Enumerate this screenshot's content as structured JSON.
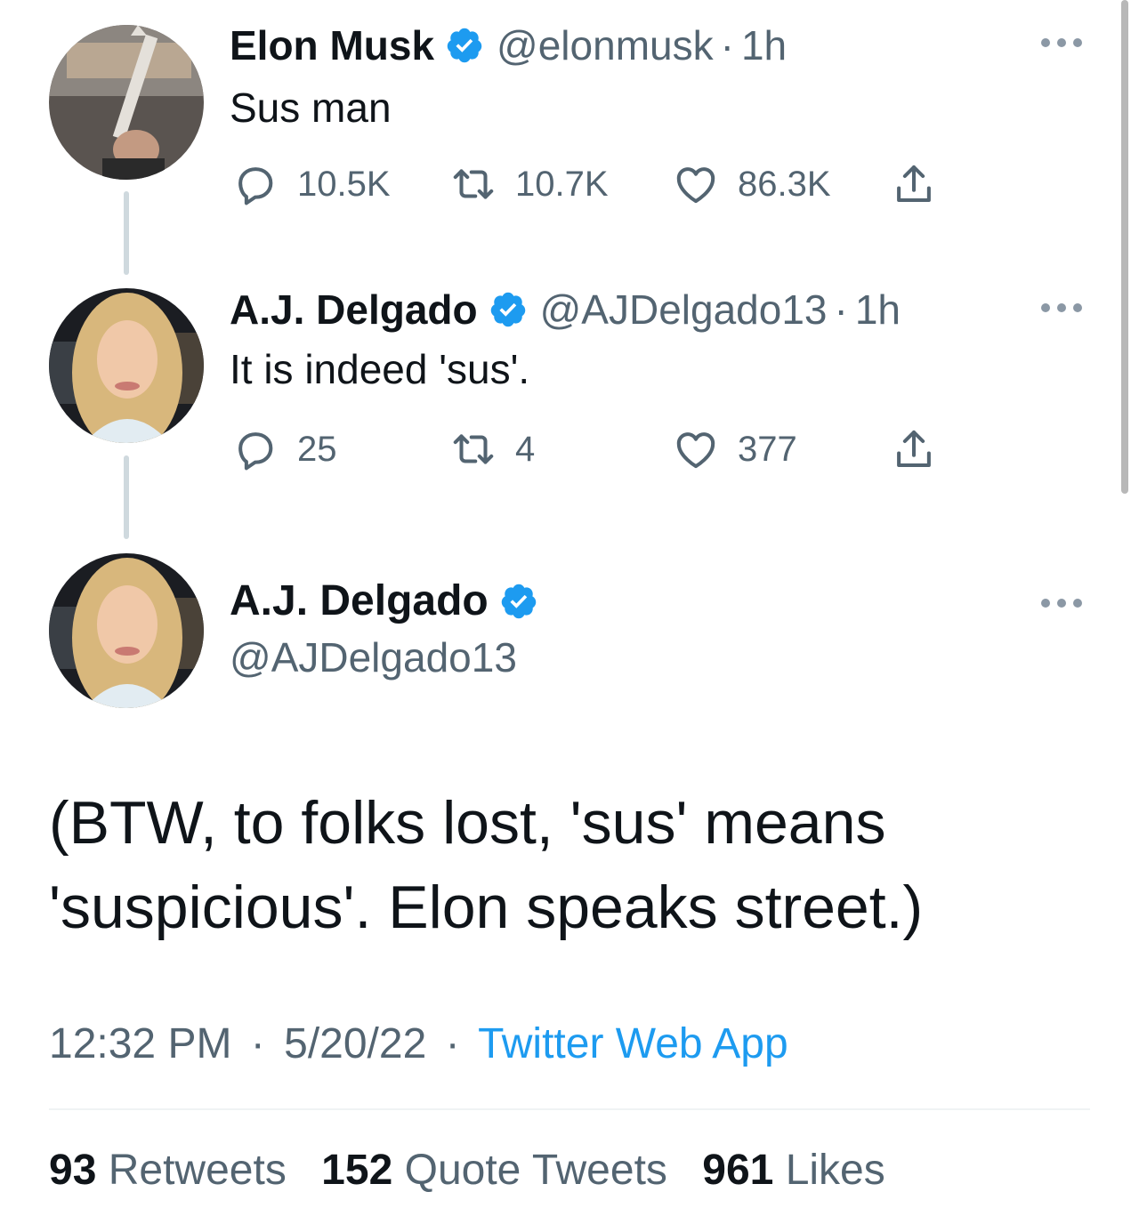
{
  "colors": {
    "text": "#0f1419",
    "secondary": "#536471",
    "verified": "#1d9bf0",
    "link": "#1d9bf0",
    "thread_line": "#cfd9de"
  },
  "tweets": [
    {
      "name": "Elon Musk",
      "verified": true,
      "handle": "@elonmusk",
      "separator": "·",
      "time": "1h",
      "text": "Sus man",
      "replies": "10.5K",
      "retweets": "10.7K",
      "likes": "86.3K",
      "icons": [
        "reply-icon",
        "retweet-icon",
        "like-icon",
        "share-icon",
        "more-icon"
      ]
    },
    {
      "name": "A.J. Delgado",
      "verified": true,
      "handle": "@AJDelgado13",
      "separator": "·",
      "time": "1h",
      "text": "It is indeed 'sus'.",
      "replies": "25",
      "retweets": "4",
      "likes": "377",
      "icons": [
        "reply-icon",
        "retweet-icon",
        "like-icon",
        "share-icon",
        "more-icon"
      ]
    }
  ],
  "main_tweet": {
    "name": "A.J. Delgado",
    "verified": true,
    "handle": "@AJDelgado13",
    "text": "(BTW, to folks lost, 'sus' means 'suspicious'. Elon speaks street.)",
    "time": "12:32 PM",
    "date": "5/20/22",
    "separator": "·",
    "source": "Twitter Web App",
    "stats": [
      {
        "count": "93",
        "label": "Retweets"
      },
      {
        "count": "152",
        "label": "Quote Tweets"
      },
      {
        "count": "961",
        "label": "Likes"
      }
    ]
  }
}
